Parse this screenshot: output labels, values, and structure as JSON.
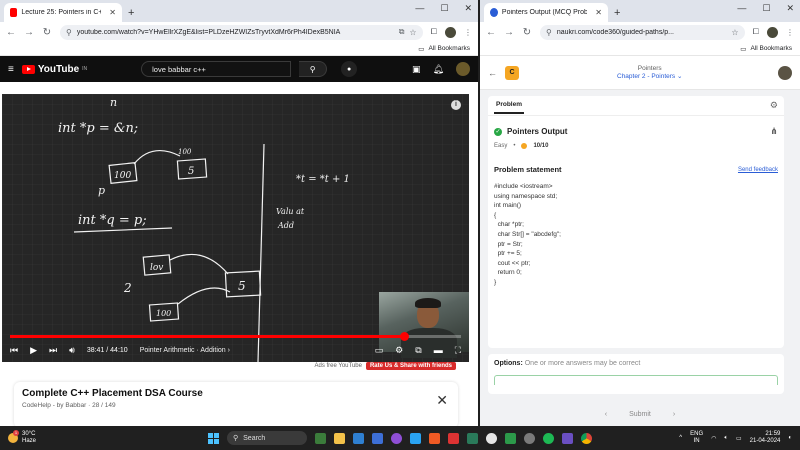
{
  "left_browser": {
    "tab_title": "Lecture 25: Pointers in C++ || P",
    "new_tab": "+",
    "url": "youtube.com/watch?v=YHwEllrXZgE&list=PLDzeHZWIZsTryvtXdMr6rPh4IDexB5NIA",
    "bookmarks": "All Bookmarks"
  },
  "youtube": {
    "logo": "YouTube",
    "region": "IN",
    "search_query": "love babbar c++",
    "time": "38:41 / 44:10",
    "chapter": "Pointer Arithmetic · Addition",
    "ads_free": "Ads free YouTube",
    "rate_us": "Rate Us & Share with friends",
    "course_title": "Complete C++ Placement DSA Course",
    "course_sub": "CodeHelp - by Babbar · 28 / 149",
    "board": {
      "n": "n",
      "line1": "int *p = &n;",
      "box100": "100",
      "box5": "5",
      "p_label": "p",
      "label100": "100",
      "line2": "int *q = p;",
      "box_lov": "lov",
      "box_100b": "100",
      "q_label": "2",
      "box5b": "5",
      "right1": "*t = *t + 1",
      "right2": "Valu at",
      "right3": "Add"
    }
  },
  "right_browser": {
    "tab_title": "Pointers Output (MCQ Problem",
    "new_tab": "+",
    "url": "naukri.com/code360/guided-paths/p...",
    "bookmarks": "All Bookmarks"
  },
  "naukri": {
    "logo": "C",
    "crumb_top": "Pointers",
    "crumb_bottom": "Chapter 2 - Pointers",
    "tab": "Problem",
    "problem_title": "Pointers Output",
    "difficulty": "Easy",
    "score": "10/10",
    "statement_heading": "Problem statement",
    "send_feedback": "Send feedback",
    "code": "#include <iostream>\nusing namespace std;\nint main()\n{\n  char *ptr;\n  char Str[] = \"abcdefg\";\n  ptr = Str;\n  ptr += 5;\n  cout << ptr;\n  return 0;\n}",
    "options_label": "Options:",
    "options_hint": "One or more answers may be correct",
    "submit": "Submit"
  },
  "taskbar": {
    "temp": "30°C",
    "weather": "Haze",
    "search": "Search",
    "lang1": "ENG",
    "lang2": "IN",
    "time": "21:59",
    "date": "21-04-2024",
    "weather_badge": "1"
  }
}
